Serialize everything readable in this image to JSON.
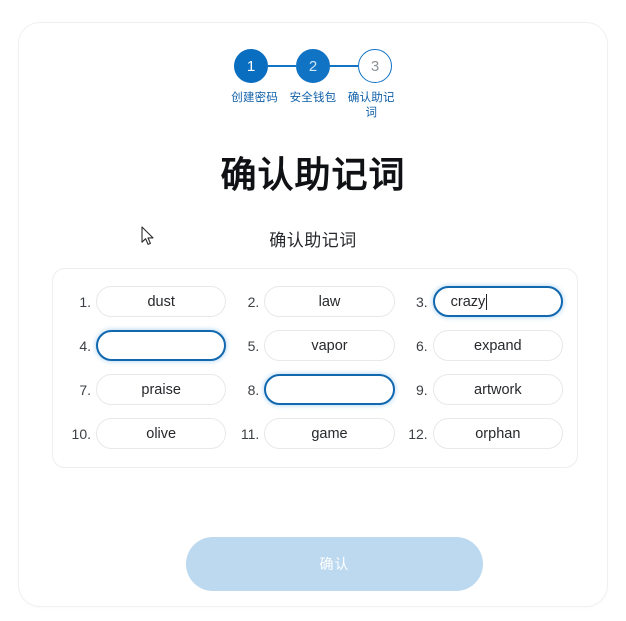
{
  "stepper": {
    "steps": [
      {
        "number": "1",
        "label": "创建密码",
        "state": "done"
      },
      {
        "number": "2",
        "label": "安全钱包",
        "state": "active"
      },
      {
        "number": "3",
        "label": "确认助记词",
        "state": "pending"
      }
    ]
  },
  "heading": {
    "title": "确认助记词",
    "subtitle": "确认助记词"
  },
  "mnemonic": {
    "cells": [
      {
        "index": "1.",
        "word": "dust",
        "focused": false,
        "empty": false
      },
      {
        "index": "2.",
        "word": "law",
        "focused": false,
        "empty": false
      },
      {
        "index": "3.",
        "word": "crazy",
        "focused": true,
        "empty": false
      },
      {
        "index": "4.",
        "word": "",
        "focused": true,
        "empty": true
      },
      {
        "index": "5.",
        "word": "vapor",
        "focused": false,
        "empty": false
      },
      {
        "index": "6.",
        "word": "expand",
        "focused": false,
        "empty": false
      },
      {
        "index": "7.",
        "word": "praise",
        "focused": false,
        "empty": false
      },
      {
        "index": "8.",
        "word": "",
        "focused": true,
        "empty": true
      },
      {
        "index": "9.",
        "word": "artwork",
        "focused": false,
        "empty": false
      },
      {
        "index": "10.",
        "word": "olive",
        "focused": false,
        "empty": false
      },
      {
        "index": "11.",
        "word": "game",
        "focused": false,
        "empty": false
      },
      {
        "index": "12.",
        "word": "orphan",
        "focused": false,
        "empty": false
      }
    ]
  },
  "actions": {
    "confirm_label": "确认",
    "confirm_disabled": true
  },
  "colors": {
    "brand_blue": "#1173c4",
    "step_done": "#0a6ec0",
    "focus_border": "#1168ae",
    "button_disabled": "#bcd9f0",
    "label_blue": "#0f5fa8"
  }
}
